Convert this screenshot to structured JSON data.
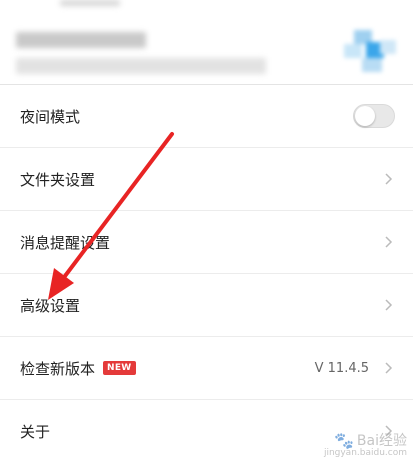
{
  "settings": {
    "night_mode": {
      "label": "夜间模式",
      "enabled": false
    },
    "folder_settings": {
      "label": "文件夹设置"
    },
    "notification_settings": {
      "label": "消息提醒设置"
    },
    "advanced_settings": {
      "label": "高级设置"
    },
    "check_update": {
      "label": "检查新版本",
      "badge": "NEW",
      "version": "V 11.4.5"
    },
    "about": {
      "label": "关于"
    }
  },
  "watermark": {
    "text": "Bai经验",
    "url": "jingyan.baidu.com"
  },
  "colors": {
    "arrow": "#e82424",
    "badge": "#e43a3a"
  },
  "icons": {
    "chevron": "chevron-right-icon",
    "watermark": "baidu-paw-icon"
  }
}
